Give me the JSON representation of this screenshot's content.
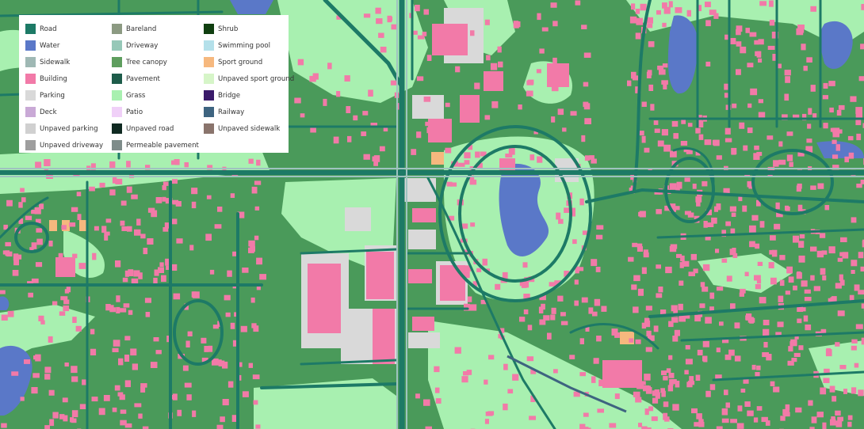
{
  "map": {
    "colors": {
      "background": "#4a9a5a",
      "road": "#1d7a66",
      "grass": "#a8f0b0",
      "building": "#f27aa8",
      "parking": "#d9d9d9",
      "water": "#5a78c8",
      "sidewalk": "#9fc3c0",
      "sport_ground": "#f6b87e",
      "pavement": "#1e5c4a",
      "shrub": "#103f10"
    }
  },
  "legend": {
    "items": [
      {
        "label": "Road",
        "color": "#1d7a66"
      },
      {
        "label": "Water",
        "color": "#5a78c8"
      },
      {
        "label": "Sidewalk",
        "color": "#9fb8b4"
      },
      {
        "label": "Building",
        "color": "#f27aa8"
      },
      {
        "label": "Parking",
        "color": "#d9d9d9"
      },
      {
        "label": "Deck",
        "color": "#c9a9d6"
      },
      {
        "label": "Unpaved parking",
        "color": "#d0d0d0"
      },
      {
        "label": "Unpaved driveway",
        "color": "#9e9e9e"
      },
      {
        "label": "Bareland",
        "color": "#8c9a82"
      },
      {
        "label": "Driveway",
        "color": "#96c8b8"
      },
      {
        "label": "Tree canopy",
        "color": "#5e9e5e"
      },
      {
        "label": "Pavement",
        "color": "#1e5c4a"
      },
      {
        "label": "Grass",
        "color": "#a8f0b0"
      },
      {
        "label": "Patio",
        "color": "#f0d0f8"
      },
      {
        "label": "Unpaved road",
        "color": "#102a22"
      },
      {
        "label": "Permeable pavement",
        "color": "#7e8c8a"
      },
      {
        "label": "Shrub",
        "color": "#103f10"
      },
      {
        "label": "Swimming pool",
        "color": "#b4e0ea"
      },
      {
        "label": "Sport ground",
        "color": "#f6b87e"
      },
      {
        "label": "Unpaved sport ground",
        "color": "#d6f5c8"
      },
      {
        "label": "Bridge",
        "color": "#3a1a6a"
      },
      {
        "label": "Railway",
        "color": "#3e6480"
      },
      {
        "label": "Unpaved sidewalk",
        "color": "#8a746c"
      }
    ]
  }
}
